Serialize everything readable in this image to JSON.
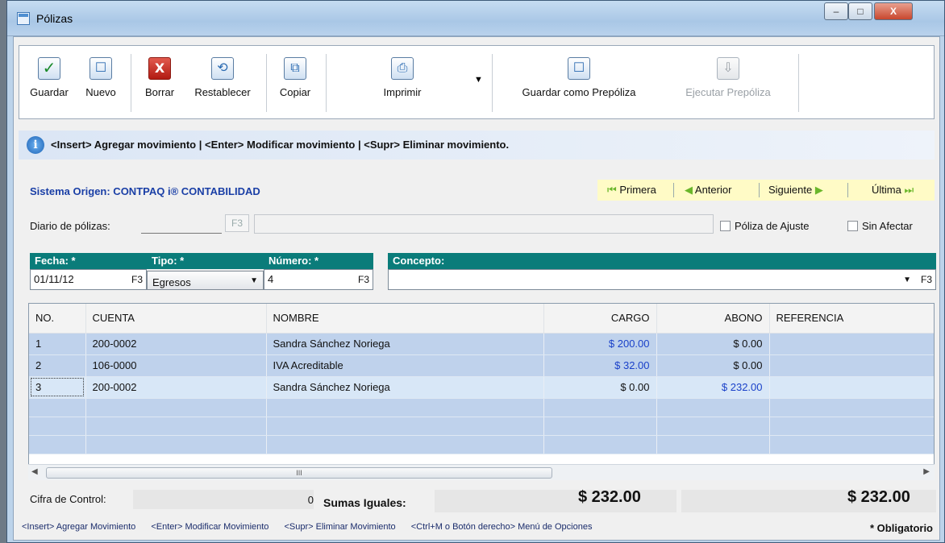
{
  "window": {
    "title": "Pólizas",
    "min": "–",
    "max": "□",
    "close": "X"
  },
  "toolbar": {
    "guardar": "Guardar",
    "nuevo": "Nuevo",
    "borrar": "Borrar",
    "restablecer": "Restablecer",
    "copiar": "Copiar",
    "imprimir": "Imprimir",
    "guardar_prepoliza": "Guardar como Prepóliza",
    "ejecutar_prepoliza": "Ejecutar Prepóliza",
    "dropdown_arrow": "▼"
  },
  "icons": {
    "check": "✓",
    "x": "X",
    "undo": "⟲",
    "copy": "⧉",
    "print": "⎙",
    "new": "☐",
    "save_pre": "☐",
    "exec_pre": "⇩"
  },
  "info": {
    "icon": "i",
    "message": "<Insert> Agregar movimiento | <Enter> Modificar movimiento | <Supr> Eliminar movimiento."
  },
  "origin": {
    "label": "Sistema Origen: CONTPAQ i® CONTABILIDAD"
  },
  "nav": {
    "primera": "Primera",
    "anterior": "Anterior",
    "siguiente": "Siguiente",
    "ultima": "Última",
    "first_icon": "⏮",
    "prev_icon": "◀",
    "next_icon": "▶",
    "last_icon": "⏭"
  },
  "diario": {
    "label": "Diario de pólizas:",
    "f3": "F3",
    "value": ""
  },
  "checks": {
    "ajuste": "Póliza de Ajuste",
    "sin_afectar": "Sin Afectar"
  },
  "form": {
    "fecha_label": "Fecha: *",
    "fecha_value": "01/11/12",
    "fecha_f3": "F3",
    "tipo_label": "Tipo: *",
    "tipo_value": "Egresos",
    "numero_label": "Número: *",
    "numero_value": "4",
    "numero_f3": "F3",
    "concepto_label": "Concepto:",
    "concepto_value": "",
    "concepto_f3": "F3"
  },
  "grid": {
    "columns": [
      "NO.",
      "CUENTA",
      "NOMBRE",
      "CARGO",
      "ABONO",
      "REFERENCIA"
    ],
    "rows": [
      {
        "no": "1",
        "cuenta": "200-0002",
        "nombre": "Sandra Sánchez Noriega",
        "cargo": "$ 200.00",
        "abono": "$ 0.00",
        "referencia": ""
      },
      {
        "no": "2",
        "cuenta": "106-0000",
        "nombre": "IVA Acreditable",
        "cargo": "$ 32.00",
        "abono": "$ 0.00",
        "referencia": ""
      },
      {
        "no": "3",
        "cuenta": "200-0002",
        "nombre": "Sandra Sánchez Noriega",
        "cargo": "$ 0.00",
        "abono": "$ 232.00",
        "referencia": ""
      }
    ]
  },
  "footer": {
    "cifra_label": "Cifra de Control:",
    "cifra_value": "0",
    "sumas_label": "Sumas Iguales:",
    "total_cargo": "$ 232.00",
    "total_abono": "$ 232.00"
  },
  "status": {
    "s1": "<Insert> Agregar Movimiento",
    "s2": "<Enter> Modificar Movimiento",
    "s3": "<Supr> Eliminar Movimiento",
    "s4": "<Ctrl+M o Botón derecho> Menú de Opciones",
    "obligatorio": "* Obligatorio"
  },
  "scroll": {
    "thumb_grip": "III",
    "left": "◀",
    "right": "▶"
  }
}
